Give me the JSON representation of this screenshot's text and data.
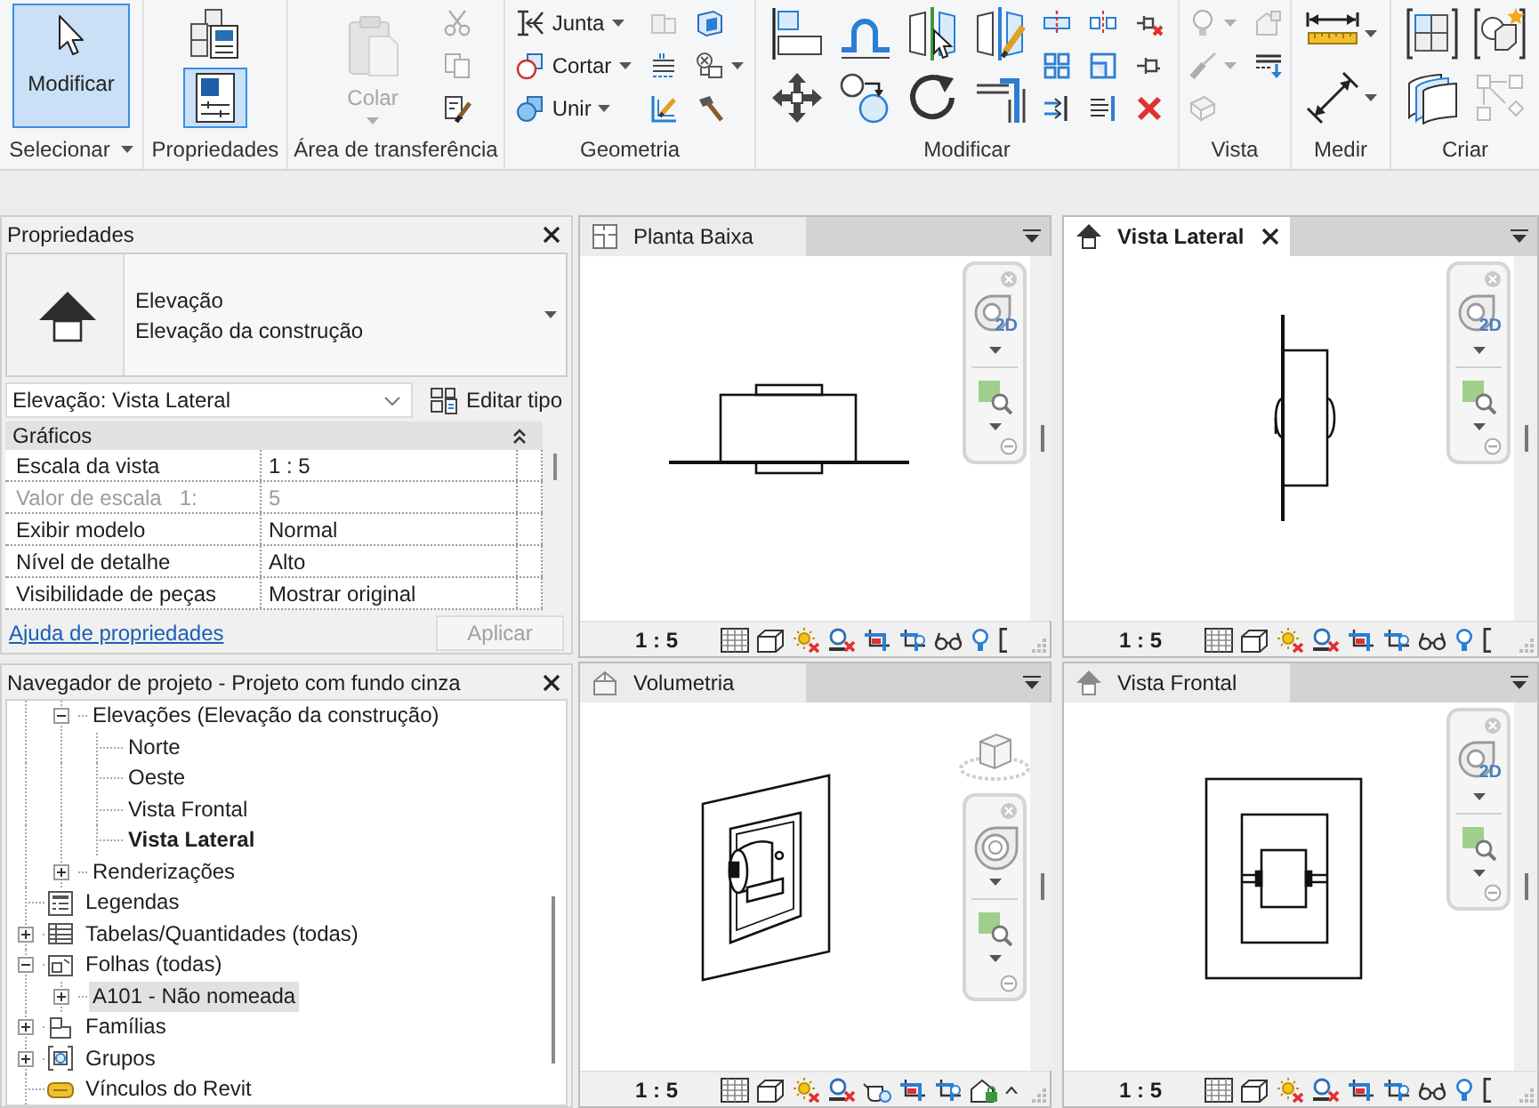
{
  "ribbon": [
    {
      "label": "Selecionar",
      "menu": true,
      "tools": [
        {
          "kind": "large",
          "label": "Modificar",
          "active": true
        }
      ]
    },
    {
      "label": "Propriedades",
      "tools": [
        {
          "kind": "medium",
          "active": false
        },
        {
          "kind": "medium",
          "active": true
        }
      ]
    },
    {
      "label": "Área de transferência",
      "tools": [
        {
          "kind": "large",
          "label": "Colar",
          "menu": true,
          "disabled": true
        },
        {
          "kind": "small",
          "disabled": true
        },
        {
          "kind": "small",
          "disabled": true
        },
        {
          "kind": "small",
          "disabled": false
        }
      ]
    },
    {
      "label": "Geometria",
      "tools": [
        {
          "kind": "small",
          "label": "Junta",
          "menu": true,
          "disabled": false
        },
        {
          "kind": "small",
          "label": "Cortar",
          "menu": true,
          "disabled": false
        },
        {
          "kind": "small",
          "label": "Unir",
          "menu": true,
          "disabled": false
        },
        {
          "kind": "small",
          "disabled": true
        },
        {
          "kind": "small",
          "disabled": false
        },
        {
          "kind": "small",
          "disabled": false
        },
        {
          "kind": "small",
          "disabled": false
        },
        {
          "kind": "small",
          "menu": true,
          "disabled": false
        },
        {
          "kind": "small",
          "disabled": false
        }
      ]
    },
    {
      "label": "Modificar",
      "tools": [
        {
          "kind": "medium"
        },
        {
          "kind": "medium"
        },
        {
          "kind": "medium"
        },
        {
          "kind": "medium"
        },
        {
          "kind": "medium"
        },
        {
          "kind": "medium"
        },
        {
          "kind": "medium"
        },
        {
          "kind": "medium"
        },
        {
          "kind": "small"
        },
        {
          "kind": "small"
        },
        {
          "kind": "small"
        },
        {
          "kind": "small"
        },
        {
          "kind": "small"
        },
        {
          "kind": "small"
        },
        {
          "kind": "small"
        },
        {
          "kind": "small"
        },
        {
          "kind": "small"
        }
      ]
    },
    {
      "label": "Vista",
      "tools": [
        {
          "kind": "small",
          "menu": true,
          "disabled": true
        },
        {
          "kind": "small",
          "menu": true,
          "disabled": true
        },
        {
          "kind": "small",
          "disabled": true
        },
        {
          "kind": "small",
          "disabled": true
        },
        {
          "kind": "small",
          "disabled": false
        }
      ]
    },
    {
      "label": "Medir",
      "tools": [
        {
          "kind": "medium",
          "menu": true
        },
        {
          "kind": "medium",
          "menu": true
        }
      ]
    },
    {
      "label": "Criar",
      "tools": [
        {
          "kind": "medium",
          "disabled": false
        },
        {
          "kind": "medium",
          "disabled": false
        },
        {
          "kind": "medium",
          "disabled": false
        },
        {
          "kind": "medium",
          "disabled": true
        }
      ]
    }
  ],
  "properties": {
    "title": "Propriedades",
    "type_family": "Elevação",
    "type_name": "Elevação da construção",
    "instance": "Elevação: Vista Lateral",
    "edit_type": "Editar tipo",
    "group": {
      "label": "Gráficos",
      "expanded": true,
      "rows": [
        {
          "name": "Escala da vista",
          "value": "1 : 5",
          "disabled": false
        },
        {
          "name": "Valor de escala",
          "unit": "1:",
          "value": "5",
          "disabled": true
        },
        {
          "name": "Exibir modelo",
          "value": "Normal",
          "disabled": false
        },
        {
          "name": "Nível de detalhe",
          "value": "Alto",
          "disabled": false
        },
        {
          "name": "Visibilidade de peças",
          "value": "Mostrar original",
          "disabled": false
        }
      ]
    },
    "help": "Ajuda de propriedades",
    "apply": {
      "label": "Aplicar",
      "disabled": true
    }
  },
  "project_browser": {
    "title": "Navegador de projeto - Projeto com fundo cinza",
    "tree": [
      {
        "children": [
          {
            "label": "Elevações (Elevação da construção)",
            "expanded": true,
            "selected": false,
            "children": [
              {
                "label": "Norte",
                "selected": false,
                "active": false
              },
              {
                "label": "Oeste",
                "selected": false,
                "active": false
              },
              {
                "label": "Vista Frontal",
                "selected": false,
                "active": false
              },
              {
                "label": "Vista Lateral",
                "selected": false,
                "active": true
              }
            ]
          },
          {
            "label": "Renderizações",
            "expanded": false,
            "selected": false
          }
        ]
      },
      {
        "label": "Legendas",
        "selected": false
      },
      {
        "label": "Tabelas/Quantidades (todas)",
        "expanded": false,
        "selected": false
      },
      {
        "label": "Folhas (todas)",
        "expanded": true,
        "selected": false,
        "children": [
          {
            "label": "A101 - Não nomeada",
            "expanded": false,
            "selected": true
          }
        ]
      },
      {
        "label": "Famílias",
        "expanded": false,
        "selected": false
      },
      {
        "label": "Grupos",
        "expanded": false,
        "selected": false
      },
      {
        "label": "Vínculos do Revit",
        "selected": false
      }
    ]
  },
  "views": [
    {
      "tab": "Planta Baixa",
      "kind": "plan",
      "selected": false,
      "wheel_label": "2D",
      "scale": "1 : 5"
    },
    {
      "tab": "Vista Lateral",
      "kind": "elevation",
      "selected": true,
      "wheel_label": "2D",
      "scale": "1 : 5"
    },
    {
      "tab": "Volumetria",
      "kind": "perspective",
      "selected": false,
      "scale": "1 : 5"
    },
    {
      "tab": "Vista Frontal",
      "kind": "elevation",
      "selected": false,
      "wheel_label": "2D",
      "scale": "1 : 5"
    }
  ]
}
